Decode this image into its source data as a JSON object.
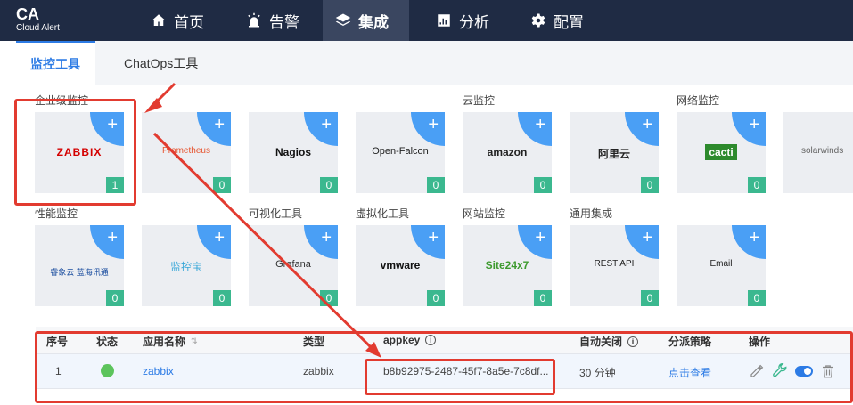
{
  "header": {
    "logo_title": "CA",
    "logo_subtitle": "Cloud Alert",
    "nav": [
      {
        "label": "首页",
        "icon": "home-icon"
      },
      {
        "label": "告警",
        "icon": "alarm-icon"
      },
      {
        "label": "集成",
        "icon": "layers-icon"
      },
      {
        "label": "分析",
        "icon": "bar-chart-icon"
      },
      {
        "label": "配置",
        "icon": "gear-icon"
      }
    ]
  },
  "tabs": [
    "监控工具",
    "ChatOps工具"
  ],
  "sections": {
    "enterprise": "企业级监控",
    "cloud": "云监控",
    "network": "网络监控",
    "performance": "性能监控",
    "visualization": "可视化工具",
    "virtualization": "虚拟化工具",
    "website": "网站监控",
    "general": "通用集成"
  },
  "tools_row1": [
    {
      "name": "ZABBIX",
      "count": "1"
    },
    {
      "name": "Prometheus",
      "count": "0"
    },
    {
      "name": "Nagios",
      "count": "0"
    },
    {
      "name": "Open-Falcon",
      "count": "0"
    },
    {
      "name": "amazon",
      "count": "0"
    },
    {
      "name": "阿里云",
      "count": "0"
    },
    {
      "name": "cacti",
      "count": "0"
    },
    {
      "name": "solarwinds",
      "count": ""
    }
  ],
  "tools_row2": [
    {
      "name": "睿象云 蓝海讯通",
      "count": "0"
    },
    {
      "name": "监控宝",
      "count": "0"
    },
    {
      "name": "Grafana",
      "count": "0"
    },
    {
      "name": "vmware",
      "count": "0"
    },
    {
      "name": "Site24x7",
      "count": "0"
    },
    {
      "name": "REST API",
      "count": "0"
    },
    {
      "name": "Email",
      "count": "0"
    }
  ],
  "table": {
    "headers": [
      "序号",
      "状态",
      "应用名称",
      "类型",
      "appkey",
      "自动关闭",
      "分派策略",
      "操作"
    ],
    "row": {
      "index": "1",
      "app_name": "zabbix",
      "type": "zabbix",
      "appkey": "b8b92975-2487-45f7-8a5e-7c8df...",
      "auto_close": "30 分钟",
      "policy": "点击查看"
    }
  },
  "colors": {
    "accent": "#2c7be5",
    "badge": "#3bb88f",
    "status_ok": "#5cc45c",
    "annotation": "#e23b30"
  }
}
